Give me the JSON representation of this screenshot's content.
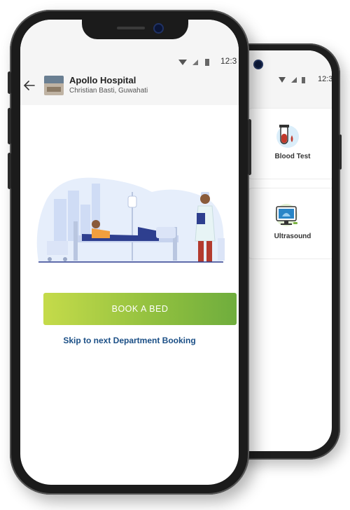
{
  "back_screen": {
    "status_time": "12:3",
    "services": [
      {
        "label": "Blood Test",
        "icon": "blood-test-icon"
      },
      {
        "label": "Ultrasound",
        "icon": "ultrasound-icon"
      }
    ]
  },
  "front_screen": {
    "status_time": "12:3",
    "header": {
      "hospital_name": "Apollo Hospital",
      "hospital_address": "Christian Basti, Guwahati"
    },
    "book_button_label": "BOOK A BED",
    "skip_link_label": "Skip to next Department Booking"
  },
  "colors": {
    "button_gradient_start": "#c5db4a",
    "button_gradient_end": "#6fad3d",
    "link": "#1b4f86"
  }
}
